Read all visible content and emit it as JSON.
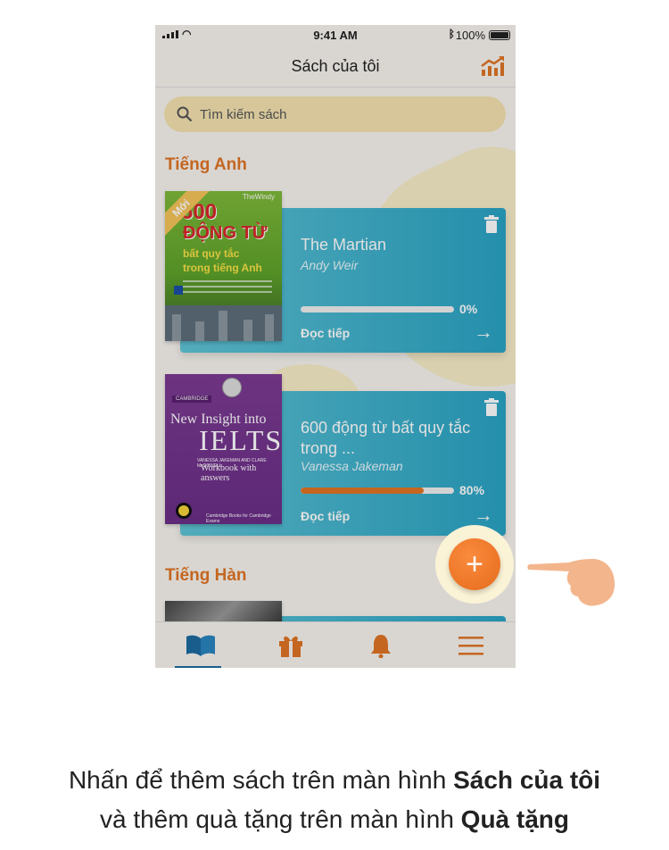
{
  "status_bar": {
    "time": "9:41 AM",
    "battery": "100%"
  },
  "header": {
    "title": "Sách của tôi",
    "stats_icon": "chart-trend-icon"
  },
  "search": {
    "placeholder": "Tìm kiếm sách"
  },
  "sections": [
    {
      "title": "Tiếng Anh"
    },
    {
      "title": "Tiếng Hàn"
    }
  ],
  "books": [
    {
      "title": "The Martian",
      "author": "Andy Weir",
      "progress_label": "0%",
      "progress": 0,
      "continue_label": "Đọc tiếp",
      "cover": {
        "badge": "Mới",
        "publisher": "TheWindy",
        "line1": "600",
        "line2": "ĐỘNG TỪ",
        "line3": "bất quy tắc",
        "line4": "trong tiếng Anh"
      }
    },
    {
      "title": "600 động từ bất quy tắc trong ...",
      "author": "Vanessa Jakeman",
      "progress_label": "80%",
      "progress": 0.8,
      "continue_label": "Đọc tiếp",
      "cover": {
        "publisher": "CAMBRIDGE",
        "line1": "New Insight into",
        "line2": "IELTS",
        "line3": "VANESSA JAKEMAN AND CLARE McDOWELL",
        "line4": "Workbook with answers",
        "footer": "Cambridge Books for Cambridge Exams"
      }
    }
  ],
  "tabbar": {
    "items": [
      {
        "icon": "book-open-icon",
        "active": true
      },
      {
        "icon": "gift-icon",
        "active": false
      },
      {
        "icon": "bell-icon",
        "active": false
      },
      {
        "icon": "menu-icon",
        "active": false
      }
    ]
  },
  "fab": {
    "label": "+"
  },
  "caption": {
    "line1_plain": "Nhấn để thêm sách trên màn hình ",
    "line1_bold": "Sách của tôi",
    "line2_plain": "và thêm quà tặng trên màn hình ",
    "line2_bold": "Quà tặng"
  },
  "colors": {
    "accent": "#e07525",
    "card": "#2aa3c4",
    "search": "#f4e2b0"
  }
}
